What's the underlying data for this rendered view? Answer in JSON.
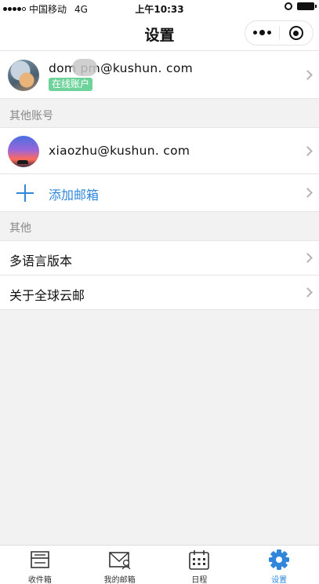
{
  "status_bar": {
    "carrier": "中国移动",
    "network": "4G",
    "time": "上午10:33"
  },
  "nav": {
    "title": "设置"
  },
  "current_account": {
    "email": "dom      pm@kushun. com",
    "badge": "在线账户"
  },
  "sections": {
    "other_accounts": "其他账号",
    "other": "其他"
  },
  "other_accounts": [
    {
      "email": "xiaozhu@kushun. com"
    }
  ],
  "add_mailbox": {
    "label": "添加邮箱"
  },
  "other_items": [
    {
      "label": "多语言版本"
    },
    {
      "label": "关于全球云邮"
    }
  ],
  "tabs": [
    {
      "label": "收件箱",
      "icon": "inbox-icon"
    },
    {
      "label": "我的邮箱",
      "icon": "mailbox-icon"
    },
    {
      "label": "日程",
      "icon": "calendar-icon"
    },
    {
      "label": "设置",
      "icon": "gear-icon",
      "active": true
    }
  ],
  "colors": {
    "accent": "#2f86db",
    "badge": "#6ed39a",
    "background": "#f2f2f2"
  }
}
